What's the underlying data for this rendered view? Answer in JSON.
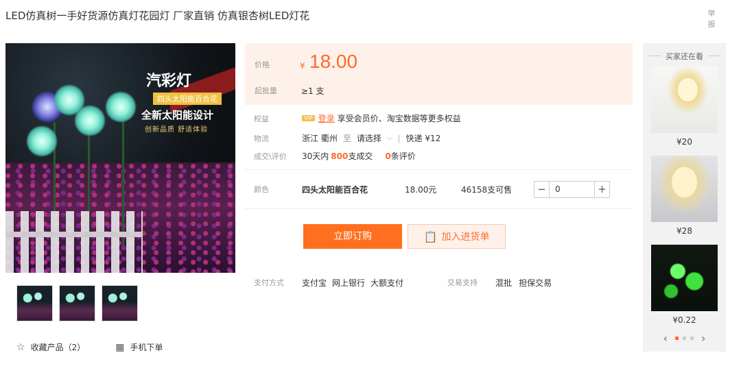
{
  "product": {
    "title": "LED仿真树一手好货源仿真灯花园灯 厂家直销 仿真银杏树LED灯花",
    "report": "举报",
    "image_overlay": {
      "headline": "汽彩灯",
      "tag": "四头太阳能百合花",
      "subtitle": "全新太阳能设计",
      "slogan": "创新品质 舒适体验"
    }
  },
  "price_panel": {
    "price_label": "价格",
    "currency": "¥",
    "price": "18.00",
    "moq_label": "起批量",
    "moq_value": "≥1 支"
  },
  "details": {
    "rights_label": "权益",
    "vip": "VIP",
    "login": "登录",
    "rights_text": "享受会员价、淘宝数据等更多权益",
    "logistics_label": "物流",
    "origin": "浙江 衢州",
    "to": "至",
    "destination": "请选择",
    "shipping": "快递 ¥12",
    "trade_label": "成交\\评价",
    "days": "30天内",
    "sold_count": "800",
    "sold_suffix": "支成交",
    "review_count": "0",
    "review_suffix": "条评价"
  },
  "sku": {
    "label": "颜色",
    "name": "四头太阳能百合花",
    "price": "18.00元",
    "stock": "46158支可售",
    "quantity": "0",
    "minus": "−",
    "plus": "+"
  },
  "actions": {
    "buy": "立即订购",
    "add_to_cart": "加入进货单"
  },
  "payment": {
    "label": "支付方式",
    "methods": [
      "支付宝",
      "网上银行",
      "大额支付"
    ],
    "trade_support_label": "交易支持",
    "support": [
      "混批",
      "担保交易"
    ]
  },
  "footer": {
    "favorite": "收藏产品（2）",
    "mobile_order": "手机下单"
  },
  "sidebar": {
    "title": "买家还在看",
    "items": [
      {
        "price": "¥20"
      },
      {
        "price": "¥28"
      },
      {
        "price": "¥0.22"
      }
    ]
  }
}
